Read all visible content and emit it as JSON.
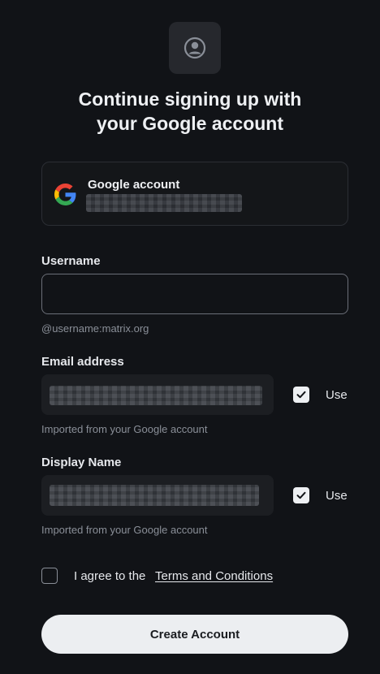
{
  "header": {
    "icon": "user-circle-icon",
    "title_line1": "Continue signing up with",
    "title_line2": "your Google account"
  },
  "account_card": {
    "icon": "google-logo-icon",
    "label": "Google account"
  },
  "username": {
    "label": "Username",
    "value": "",
    "placeholder": "",
    "hint": "@username:matrix.org"
  },
  "email": {
    "label": "Email address",
    "use_label": "Use",
    "use_checked": true,
    "hint": "Imported from your Google account"
  },
  "display_name": {
    "label": "Display Name",
    "use_label": "Use",
    "use_checked": true,
    "hint": "Imported from your Google account"
  },
  "agreement": {
    "checked": false,
    "text": "I agree to the",
    "link": "Terms and Conditions"
  },
  "submit": {
    "label": "Create Account"
  },
  "colors": {
    "background": "#111317",
    "button_bg": "#eceef1",
    "text": "#e6e8ec",
    "muted": "#8a8f98"
  }
}
